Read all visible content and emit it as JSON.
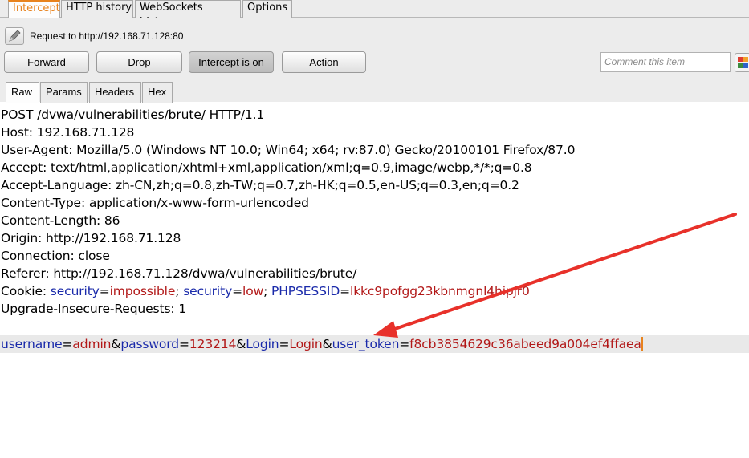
{
  "tabs": [
    "Intercept",
    "HTTP history",
    "WebSockets history",
    "Options"
  ],
  "request_label": "Request to http://192.168.71.128:80",
  "buttons": {
    "forward": "Forward",
    "drop": "Drop",
    "intercept": "Intercept is on",
    "action": "Action"
  },
  "comment_placeholder": "Comment this item",
  "subtabs": [
    "Raw",
    "Params",
    "Headers",
    "Hex"
  ],
  "request": {
    "line1": "POST /dvwa/vulnerabilities/brute/ HTTP/1.1",
    "line2": "Host: 192.168.71.128",
    "line3": "User-Agent: Mozilla/5.0 (Windows NT 10.0; Win64; x64; rv:87.0) Gecko/20100101 Firefox/87.0",
    "line4": "Accept: text/html,application/xhtml+xml,application/xml;q=0.9,image/webp,*/*;q=0.8",
    "line5": "Accept-Language: zh-CN,zh;q=0.8,zh-TW;q=0.7,zh-HK;q=0.5,en-US;q=0.3,en;q=0.2",
    "line6": "Content-Type: application/x-www-form-urlencoded",
    "line7": "Content-Length: 86",
    "line8": "Origin: http://192.168.71.128",
    "line9": "Connection: close",
    "line10": "Referer: http://192.168.71.128/dvwa/vulnerabilities/brute/",
    "cookie": {
      "prefix": "Cookie: ",
      "k1": "security",
      "v1": "impossible",
      "k2": "security",
      "v2": "low",
      "k3": "PHPSESSID",
      "v3": "lkkc9pofgg23kbnmgnl4hipjr0"
    },
    "line12": "Upgrade-Insecure-Requests: 1",
    "body": {
      "k1": "username",
      "v1": "admin",
      "k2": "password",
      "v2": "123214",
      "k3": "Login",
      "v3": "Login",
      "k4": "user_token",
      "v4": "f8cb3854629c36abeed9a004ef4ffaea"
    }
  },
  "colors": {
    "accent": "#e8831e",
    "param_name": "#1a2aaa",
    "param_value": "#b21818",
    "annotation": "#e8312a"
  }
}
